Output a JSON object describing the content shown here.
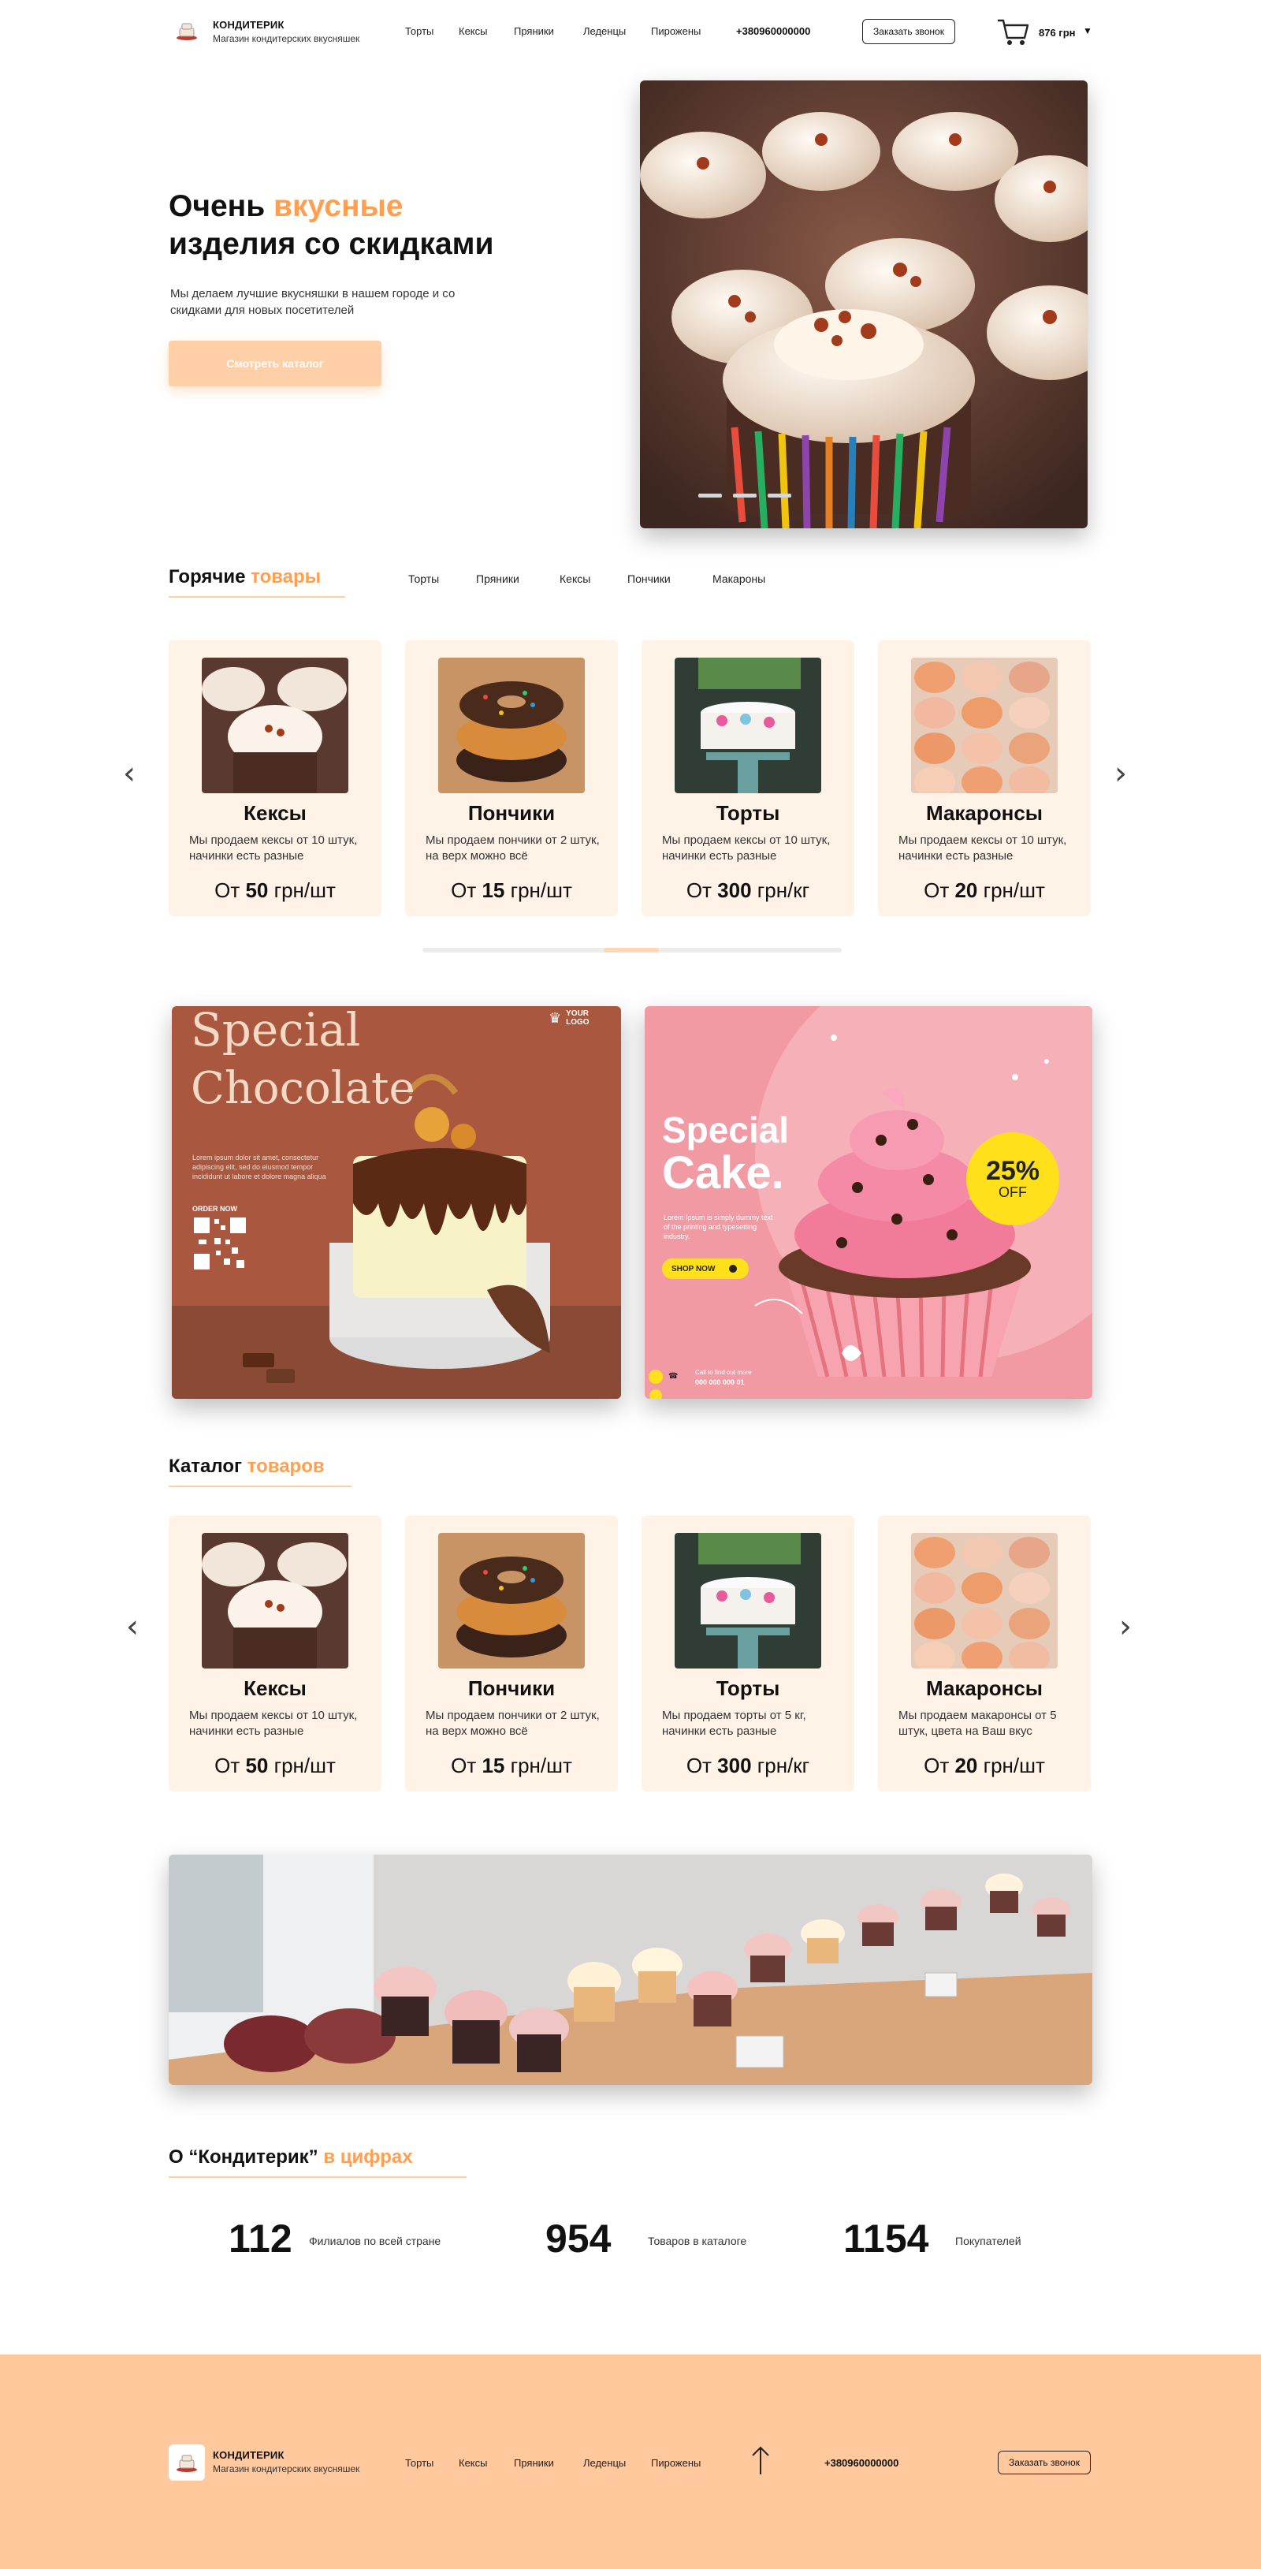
{
  "header": {
    "brand_name": "КОНДИТЕРИК",
    "brand_sub": "Магазин кондитерских вкусняшек",
    "nav": [
      "Торты",
      "Кексы",
      "Пряники",
      "Леденцы",
      "Пирожены"
    ],
    "phone": "+380960000000",
    "call_button": "Заказать звонок",
    "cart_total": "876 грн"
  },
  "hero": {
    "title_part1": "Очень ",
    "title_accent": "вкусные",
    "title_part2": "изделия со скидками",
    "description": "Мы делаем лучшие вкусняшки в нашем городе и со скидками для новых посетителей",
    "cta": "Смотреть каталог"
  },
  "hot": {
    "title": "Горячие ",
    "title_accent": "товары",
    "tabs": [
      "Торты",
      "Пряники",
      "Кексы",
      "Пончики",
      "Макароны"
    ],
    "cards": [
      {
        "title": "Кексы",
        "desc": "Мы продаем кексы от 10 штук, начинки есть разные",
        "price_prefix": "От ",
        "price": "50",
        "unit": " грн/шт"
      },
      {
        "title": "Пончики",
        "desc": "Мы продаем пончики от 2 штук, на верх можно всё",
        "price_prefix": "От ",
        "price": "15",
        "unit": " грн/шт"
      },
      {
        "title": "Торты",
        "desc": "Мы продаем кексы от 10 штук, начинки есть разные",
        "price_prefix": "От ",
        "price": "300",
        "unit": " грн/кг"
      },
      {
        "title": "Макаронсы",
        "desc": "Мы продаем кексы от 10 штук, начинки есть разные",
        "price_prefix": "От ",
        "price": "20",
        "unit": " грн/шт"
      }
    ]
  },
  "promo": {
    "chocolate": {
      "title1": "Special",
      "title2": "Chocolate",
      "logo": "YOUR LOGO",
      "body": "Lorem ipsum dolor sit amet, consectetur adipiscing elit, sed do eiusmod tempor incididunt ut labore et dolore magna aliqua",
      "order": "ORDER NOW"
    },
    "cake": {
      "title1": "Special",
      "title2": "Cake.",
      "badge_pct": "25%",
      "badge_off": "OFF",
      "body": "Lorem Ipsum is simply dummy text of the printing and typesetting industry.",
      "shop": "SHOP NOW",
      "call_label": "Call to find out more",
      "call_number": "000 000 000 01"
    }
  },
  "catalog": {
    "title": "Каталог ",
    "title_accent": "товаров",
    "cards": [
      {
        "title": "Кексы",
        "desc": "Мы продаем кексы от 10 штук, начинки есть разные",
        "price_prefix": "От ",
        "price": "50",
        "unit": " грн/шт"
      },
      {
        "title": "Пончики",
        "desc": "Мы продаем пончики от 2 штук, на верх можно всё",
        "price_prefix": "От ",
        "price": "15",
        "unit": " грн/шт"
      },
      {
        "title": "Торты",
        "desc": "Мы продаем торты от 5 кг, начинки есть разные",
        "price_prefix": "От ",
        "price": "300",
        "unit": " грн/кг"
      },
      {
        "title": "Макаронсы",
        "desc": "Мы продаем макаронсы от 5 штук, цвета на Ваш вкус",
        "price_prefix": "От ",
        "price": "20",
        "unit": " грн/шт"
      }
    ]
  },
  "about": {
    "title": "О “Кондитерик” ",
    "title_accent": "в цифрах",
    "stats": [
      {
        "num": "112",
        "label": "Филиалов по всей стране"
      },
      {
        "num": "954",
        "label": "Товаров в каталоге"
      },
      {
        "num": "1154",
        "label": "Покупателей"
      }
    ]
  },
  "footer": {
    "brand_name": "КОНДИТЕРИК",
    "brand_sub": "Магазин кондитерских вкусняшек",
    "nav": [
      "Торты",
      "Кексы",
      "Пряники",
      "Леденцы",
      "Пирожены"
    ],
    "phone": "+380960000000",
    "call_button": "Заказать звонок"
  },
  "colors": {
    "accent": "#ff9f4f",
    "peach": "#ffc89d",
    "card_bg": "#fff3e8"
  }
}
